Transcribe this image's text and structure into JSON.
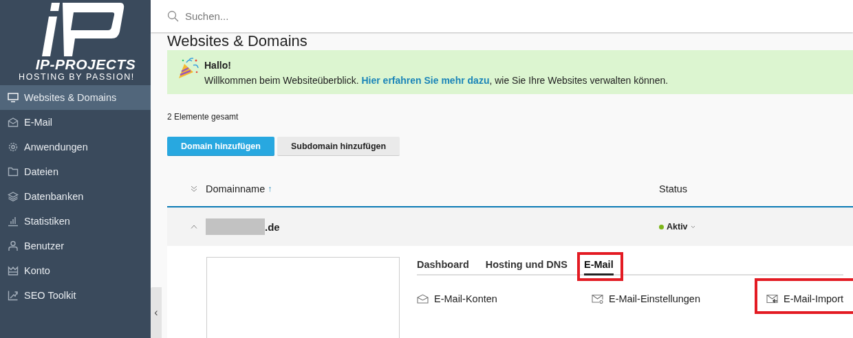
{
  "logo": {
    "name": "IP-PROJECTS",
    "tagline": "HOSTING BY PASSION!"
  },
  "sidebar": {
    "items": [
      {
        "label": "Websites & Domains",
        "selected": true
      },
      {
        "label": "E-Mail",
        "selected": false
      },
      {
        "label": "Anwendungen",
        "selected": false
      },
      {
        "label": "Dateien",
        "selected": false
      },
      {
        "label": "Datenbanken",
        "selected": false
      },
      {
        "label": "Statistiken",
        "selected": false
      },
      {
        "label": "Benutzer",
        "selected": false
      },
      {
        "label": "Konto",
        "selected": false
      },
      {
        "label": "SEO Toolkit",
        "selected": false
      }
    ],
    "collapse": "‹"
  },
  "search": {
    "placeholder": "Suchen..."
  },
  "page_title": "Websites & Domains",
  "banner": {
    "title": "Hallo!",
    "text_before": "Willkommen beim Websiteüberblick. ",
    "link": "Hier erfahren Sie mehr dazu",
    "text_after": ", wie Sie Ihre Websites verwalten können."
  },
  "total": "2 Elemente gesamt",
  "buttons": [
    {
      "label": "Domain hinzufügen",
      "kind": "primary"
    },
    {
      "label": "Subdomain hinzufügen",
      "kind": "secondary"
    }
  ],
  "table": {
    "columns": [
      {
        "label": "Domainname",
        "sort": "↑"
      },
      {
        "label": "Status"
      }
    ],
    "rows": [
      {
        "domain": ".de",
        "redacted": true,
        "expanded": true,
        "status": "Aktiv",
        "color": "#7cb518",
        "tabs": [
          {
            "label": "Dashboard",
            "selected": false,
            "highlighted": false
          },
          {
            "label": "Hosting und DNS",
            "selected": false,
            "highlighted": false
          },
          {
            "label": "E-Mail",
            "selected": true,
            "highlighted": true
          }
        ],
        "links": [
          {
            "label": "E-Mail-Konten",
            "highlighted": false
          },
          {
            "label": "E-Mail-Einstellungen",
            "highlighted": false
          },
          {
            "label": "E-Mail-Import",
            "highlighted": true
          }
        ]
      }
    ]
  }
}
